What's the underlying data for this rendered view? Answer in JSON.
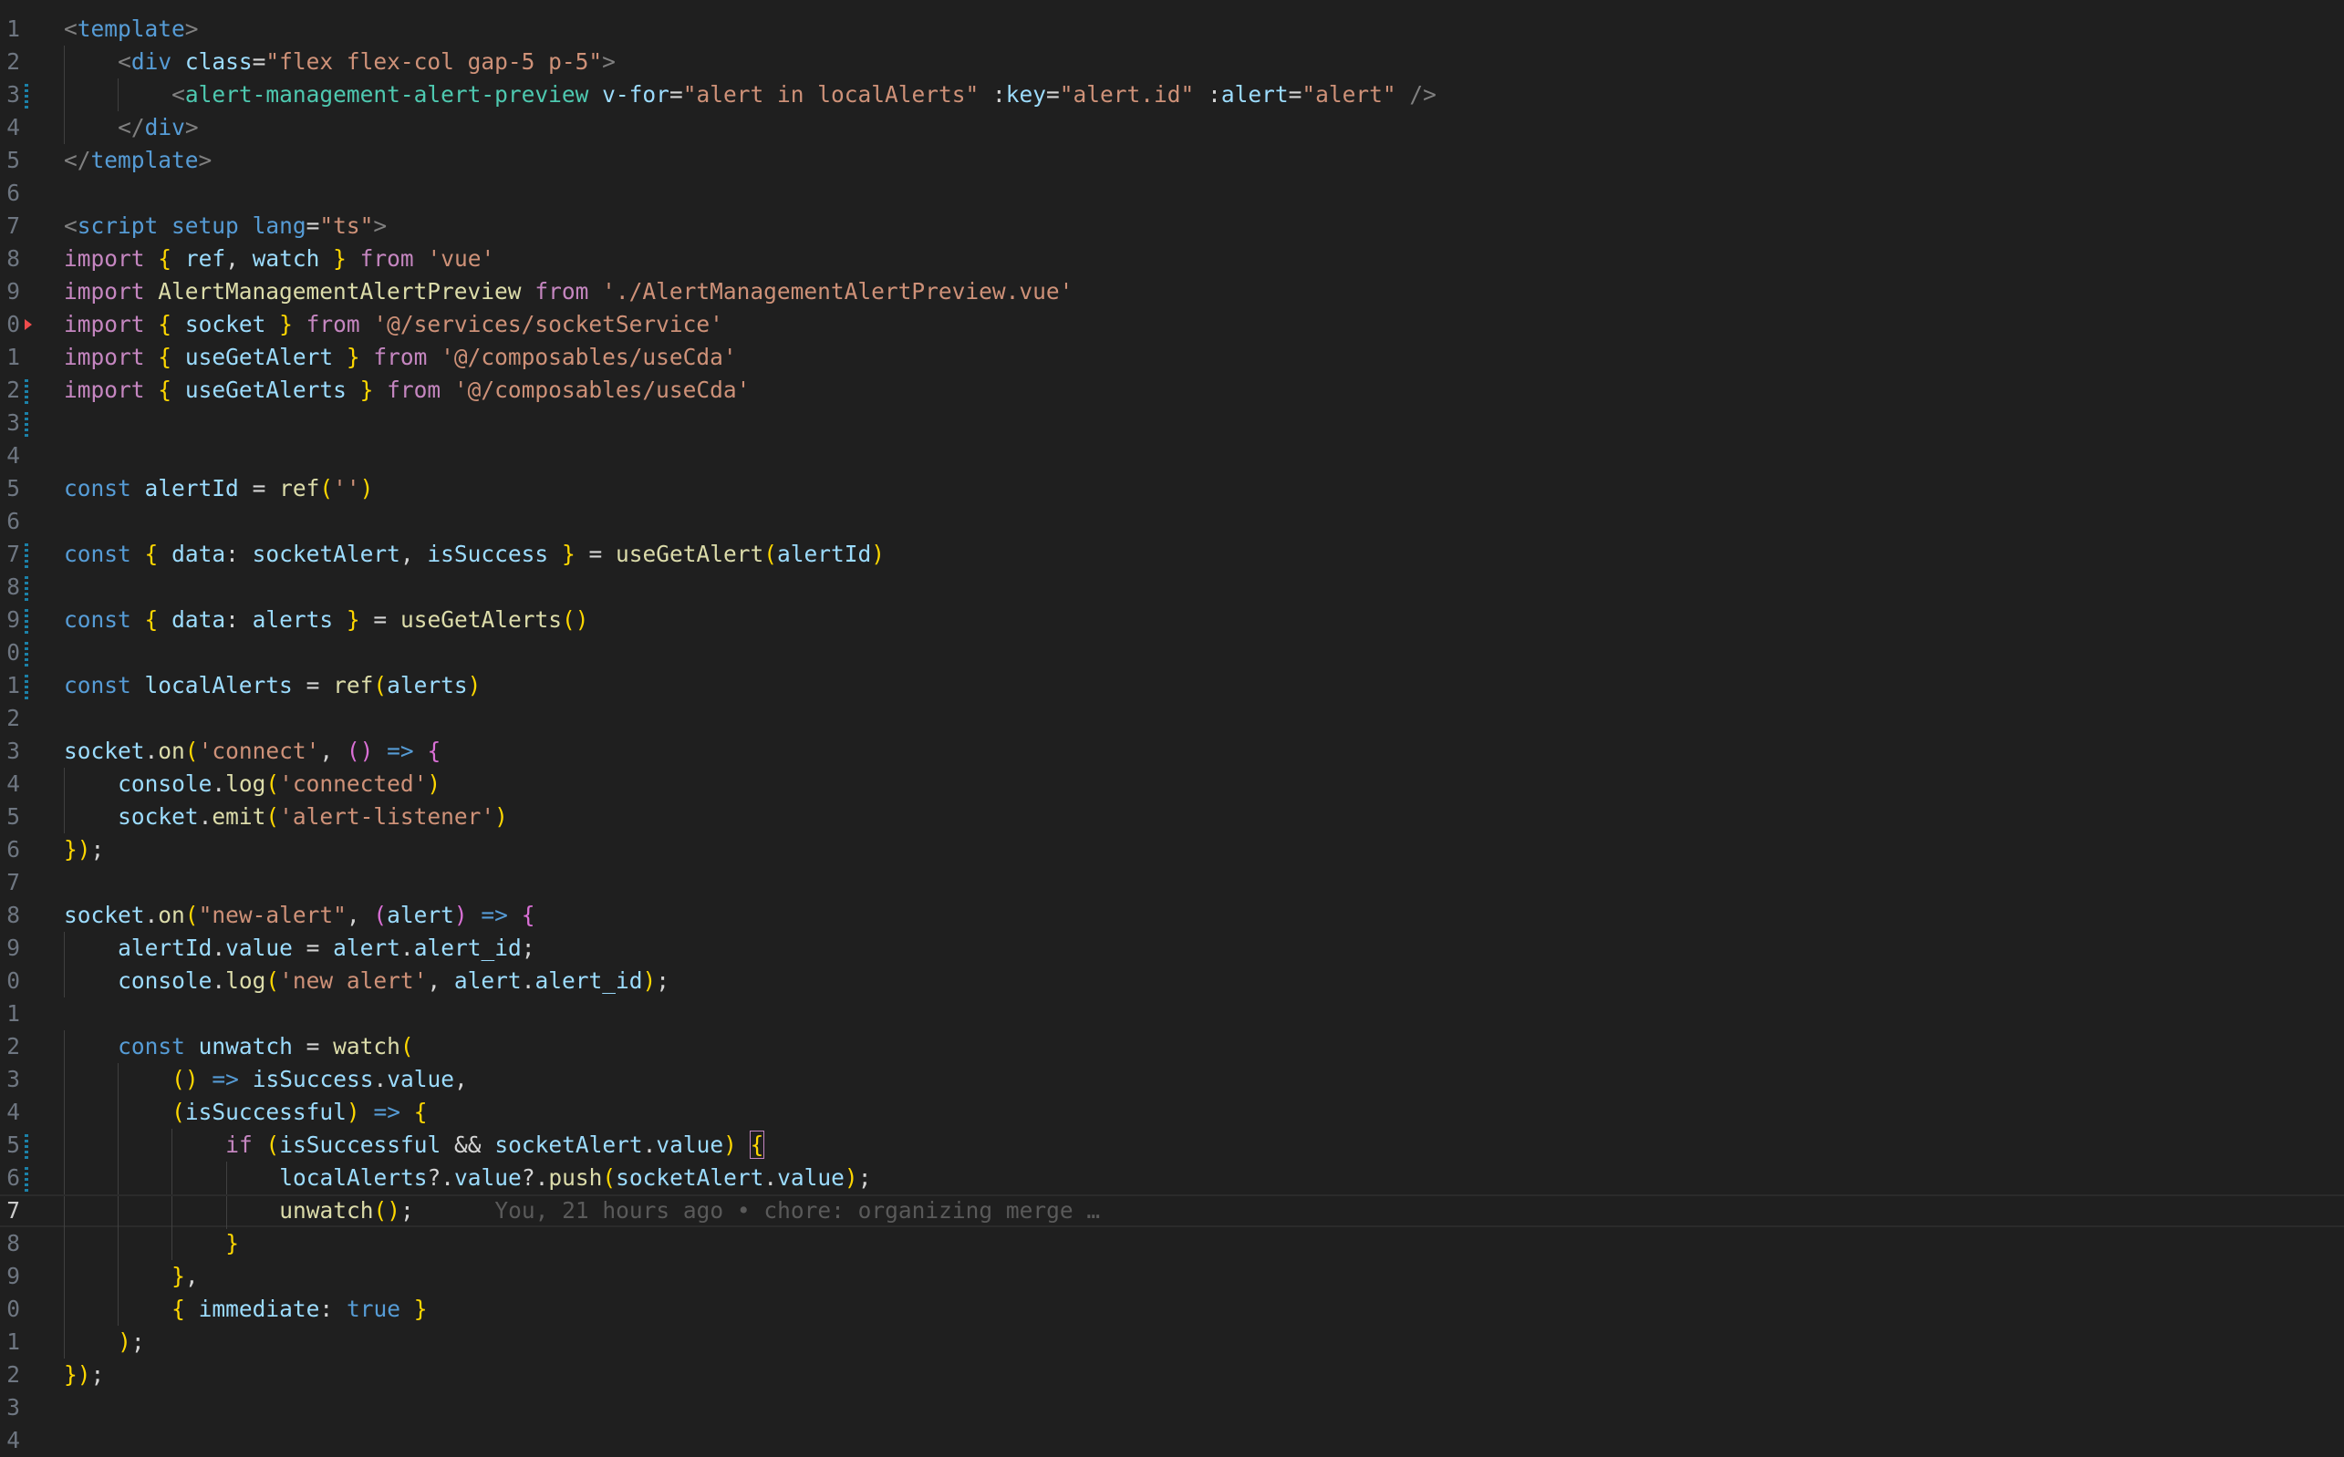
{
  "editor": {
    "language": "vue",
    "active_line": 37,
    "blame": "You, 21 hours ago • chore: organizing merge …",
    "line_number_labels": [
      "1",
      "2",
      "3",
      "4",
      "5",
      "6",
      "7",
      "8",
      "9",
      "0",
      "1",
      "2",
      "3",
      "4",
      "5",
      "6",
      "7",
      "8",
      "9",
      "0",
      "1",
      "2",
      "3",
      "4",
      "5",
      "6",
      "7",
      "8",
      "9",
      "0",
      "1",
      "2",
      "3",
      "4",
      "5",
      "6",
      "7",
      "8",
      "9",
      "0",
      "1",
      "2",
      "3",
      "4"
    ],
    "lines": [
      "<template>",
      "    <div class=\"flex flex-col gap-5 p-5\">",
      "        <alert-management-alert-preview v-for=\"alert in localAlerts\" :key=\"alert.id\" :alert=\"alert\" />",
      "    </div>",
      "</template>",
      "",
      "<script setup lang=\"ts\">",
      "import { ref, watch } from 'vue'",
      "import AlertManagementAlertPreview from './AlertManagementAlertPreview.vue'",
      "import { socket } from '@/services/socketService'",
      "import { useGetAlert } from '@/composables/useCda'",
      "import { useGetAlerts } from '@/composables/useCda'",
      "",
      "",
      "const alertId = ref('')",
      "",
      "const { data: socketAlert, isSuccess } = useGetAlert(alertId)",
      "",
      "const { data: alerts } = useGetAlerts()",
      "",
      "const localAlerts = ref(alerts)",
      "",
      "socket.on('connect', () => {",
      "    console.log('connected')",
      "    socket.emit('alert-listener')",
      "});",
      "",
      "socket.on(\"new-alert\", (alert) => {",
      "    alertId.value = alert.alert_id;",
      "    console.log('new alert', alert.alert_id);",
      "",
      "    const unwatch = watch(",
      "        () => isSuccess.value,",
      "        (isSuccessful) => {",
      "            if (isSuccessful && socketAlert.value) {",
      "                localAlerts?.value?.push(socketAlert.value);",
      "                unwatch();",
      "            }",
      "        },",
      "        { immediate: true }",
      "    );",
      "});",
      "",
      ""
    ]
  }
}
